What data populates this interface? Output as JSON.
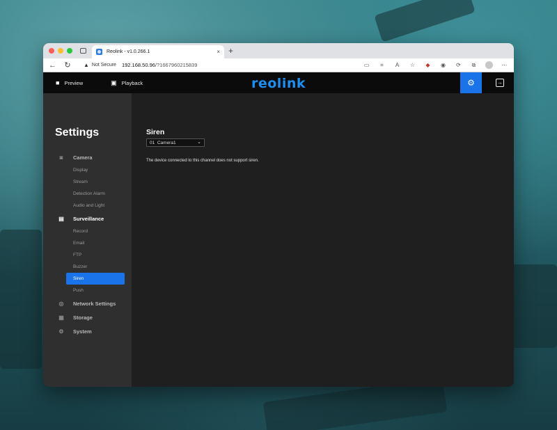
{
  "browser": {
    "tab_title": "Reolink - v1.0.266.1",
    "tab_close": "×",
    "new_tab": "+",
    "security_label": "Not Secure",
    "url_host": "192.168.50.96",
    "url_rest": "/?1667960215839"
  },
  "app": {
    "nav": [
      {
        "label": "Preview",
        "icon": "video-camera-icon"
      },
      {
        "label": "Playback",
        "icon": "film-icon"
      }
    ],
    "logo": "reolink",
    "accent_color": "#1a73e8"
  },
  "sidebar": {
    "title": "Settings",
    "groups": [
      {
        "label": "Camera",
        "icon": "camera-icon",
        "items": [
          "Display",
          "Stream",
          "Detection Alarm",
          "Audio and Light"
        ]
      },
      {
        "label": "Surveillance",
        "icon": "monitor-icon",
        "items": [
          "Record",
          "Email",
          "FTP",
          "Buzzer",
          "Siren",
          "Push"
        ]
      },
      {
        "label": "Network Settings",
        "icon": "globe-icon",
        "items": []
      },
      {
        "label": "Storage",
        "icon": "storage-icon",
        "items": []
      },
      {
        "label": "System",
        "icon": "gear-icon",
        "items": []
      }
    ],
    "active_item": "Siren"
  },
  "main": {
    "title": "Siren",
    "channel_select": "01  Camera1",
    "message": "The device connected to this channel does not support siren."
  }
}
